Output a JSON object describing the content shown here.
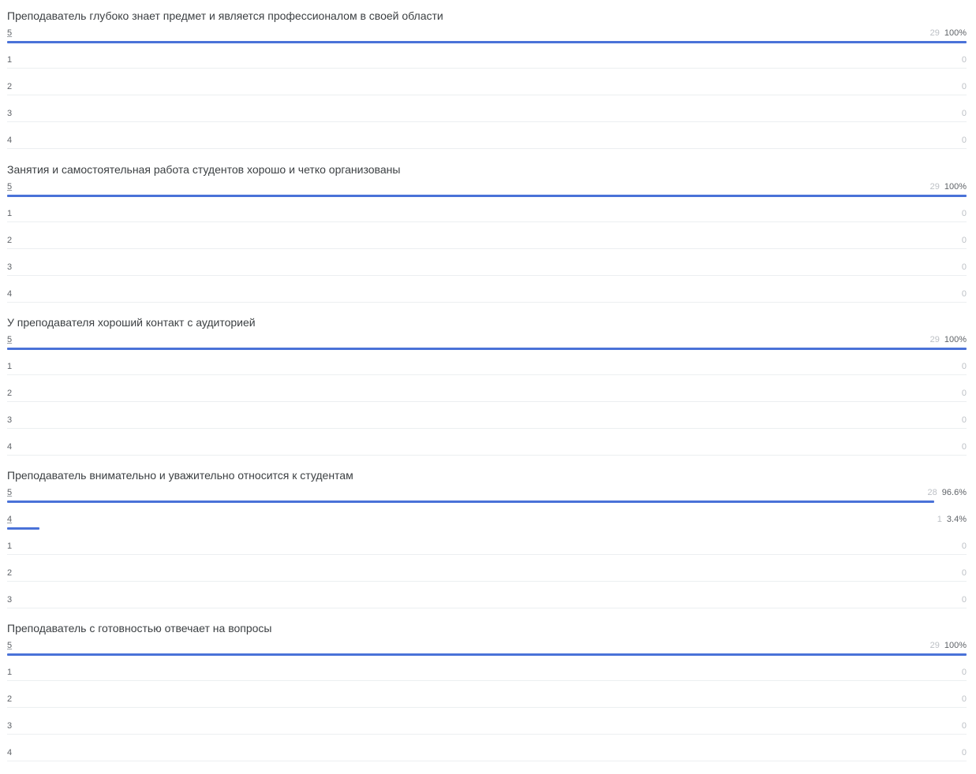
{
  "questions": [
    {
      "title": "Преподаватель глубоко знает предмет и является профессионалом в своей области",
      "rows": [
        {
          "label": "5",
          "count": "29",
          "percent": "100%",
          "fraction": 1.0
        },
        {
          "label": "1",
          "count": "0",
          "percent": "",
          "fraction": 0
        },
        {
          "label": "2",
          "count": "0",
          "percent": "",
          "fraction": 0
        },
        {
          "label": "3",
          "count": "0",
          "percent": "",
          "fraction": 0
        },
        {
          "label": "4",
          "count": "0",
          "percent": "",
          "fraction": 0
        }
      ]
    },
    {
      "title": "Занятия и самостоятельная работа студентов хорошо и четко организованы",
      "rows": [
        {
          "label": "5",
          "count": "29",
          "percent": "100%",
          "fraction": 1.0
        },
        {
          "label": "1",
          "count": "0",
          "percent": "",
          "fraction": 0
        },
        {
          "label": "2",
          "count": "0",
          "percent": "",
          "fraction": 0
        },
        {
          "label": "3",
          "count": "0",
          "percent": "",
          "fraction": 0
        },
        {
          "label": "4",
          "count": "0",
          "percent": "",
          "fraction": 0
        }
      ]
    },
    {
      "title": "У преподавателя хороший контакт с аудиторией",
      "rows": [
        {
          "label": "5",
          "count": "29",
          "percent": "100%",
          "fraction": 1.0
        },
        {
          "label": "1",
          "count": "0",
          "percent": "",
          "fraction": 0
        },
        {
          "label": "2",
          "count": "0",
          "percent": "",
          "fraction": 0
        },
        {
          "label": "3",
          "count": "0",
          "percent": "",
          "fraction": 0
        },
        {
          "label": "4",
          "count": "0",
          "percent": "",
          "fraction": 0
        }
      ]
    },
    {
      "title": "Преподаватель внимательно и уважительно относится к студентам",
      "rows": [
        {
          "label": "5",
          "count": "28",
          "percent": "96.6%",
          "fraction": 0.966
        },
        {
          "label": "4",
          "count": "1",
          "percent": "3.4%",
          "fraction": 0.034
        },
        {
          "label": "1",
          "count": "0",
          "percent": "",
          "fraction": 0
        },
        {
          "label": "2",
          "count": "0",
          "percent": "",
          "fraction": 0
        },
        {
          "label": "3",
          "count": "0",
          "percent": "",
          "fraction": 0
        }
      ]
    },
    {
      "title": "Преподаватель с готовностью отвечает на вопросы",
      "rows": [
        {
          "label": "5",
          "count": "29",
          "percent": "100%",
          "fraction": 1.0
        },
        {
          "label": "1",
          "count": "0",
          "percent": "",
          "fraction": 0
        },
        {
          "label": "2",
          "count": "0",
          "percent": "",
          "fraction": 0
        },
        {
          "label": "3",
          "count": "0",
          "percent": "",
          "fraction": 0
        },
        {
          "label": "4",
          "count": "0",
          "percent": "",
          "fraction": 0
        }
      ]
    }
  ],
  "colors": {
    "bar": "#4a72d8",
    "divider": "#eceff1"
  }
}
